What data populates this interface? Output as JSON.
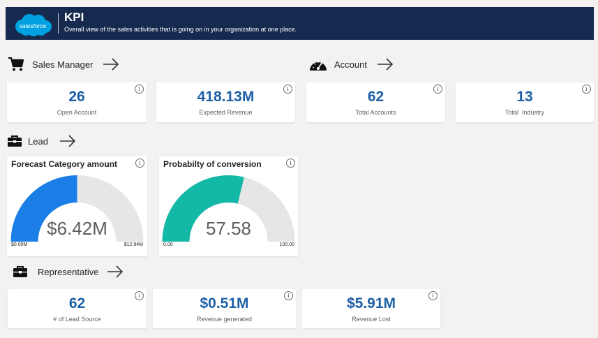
{
  "header": {
    "logo_text": "salesforce",
    "title": "KPI",
    "subtitle": "Overall view of the sales activities that is going on in your organization at one place."
  },
  "sections": {
    "sales_manager": "Sales Manager",
    "account": "Account",
    "lead": "Lead",
    "representative": "Representative"
  },
  "kpis": {
    "open_account": {
      "value": "26",
      "label": "Open Account"
    },
    "expected_revenue": {
      "value": "418.13M",
      "label": "Expected Revenue"
    },
    "total_accounts": {
      "value": "62",
      "label": "Total Accounts"
    },
    "total_industry": {
      "value": "13",
      "label": "Total  Industry"
    },
    "lead_source": {
      "value": "62",
      "label": "# of Lead Source"
    },
    "revenue_generated": {
      "value": "$0.51M",
      "label": "Revenue generated"
    },
    "revenue_lost": {
      "value": "$5.91M",
      "label": "Revenue Lost"
    }
  },
  "gauges": {
    "forecast": {
      "title": "Forecast Category amount",
      "value_label": "$6.42M",
      "min_label": "$0.00M",
      "max_label": "$12.84M",
      "fraction": 0.5,
      "color": "#1a7ee6"
    },
    "conversion": {
      "title": "Probabilty of conversion",
      "value_label": "57.58",
      "min_label": "0.00",
      "max_label": "100.00",
      "fraction": 0.5758,
      "color": "#13b8a6"
    }
  },
  "info_glyph": "i",
  "colors": {
    "header_bg": "#162a4f",
    "kpi_value": "#1d5fa6",
    "gauge_track": "#e6e6e6",
    "logo": "#00a1e0"
  },
  "icons": {
    "sales_manager": "shopping-cart-icon",
    "account": "speedometer-icon",
    "lead": "briefcase-icon",
    "representative": "briefcase-icon",
    "arrow": "arrow-right-icon",
    "info": "info-icon"
  }
}
